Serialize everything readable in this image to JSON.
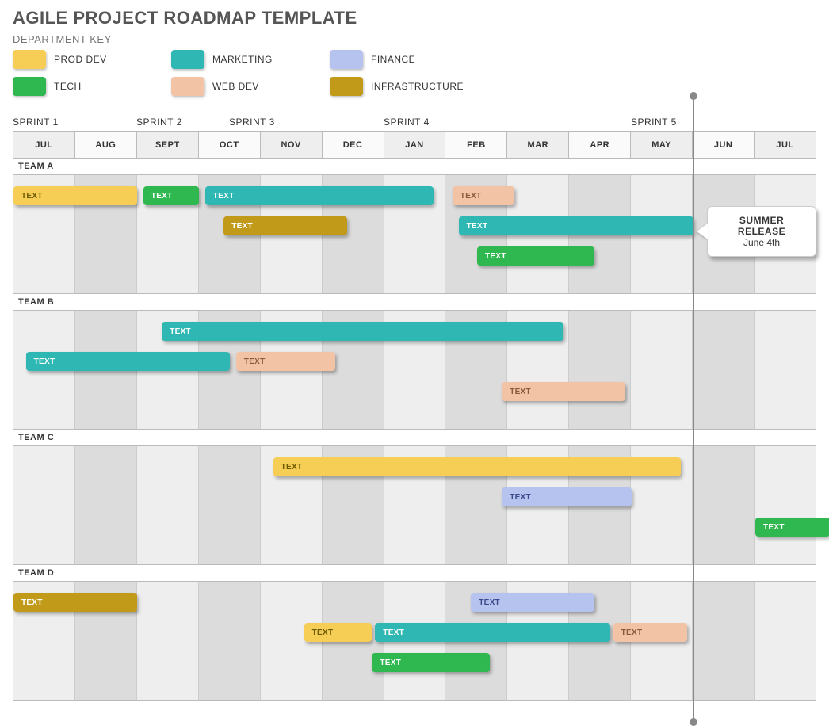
{
  "title": "AGILE PROJECT ROADMAP TEMPLATE",
  "key_title": "DEPARTMENT KEY",
  "colors": {
    "prod_dev": "#f6cd55",
    "marketing": "#2fb8b3",
    "finance": "#b6c3ef",
    "tech": "#2fb84f",
    "web_dev": "#f3c3a6",
    "infrastructure": "#c19a1a"
  },
  "legend": [
    {
      "label": "PROD DEV",
      "color": "prod_dev"
    },
    {
      "label": "MARKETING",
      "color": "marketing"
    },
    {
      "label": "FINANCE",
      "color": "finance"
    },
    {
      "label": "TECH",
      "color": "tech"
    },
    {
      "label": "WEB DEV",
      "color": "web_dev"
    },
    {
      "label": "INFRASTRUCTURE",
      "color": "infrastructure"
    }
  ],
  "sprints": [
    {
      "label": "SPRINT 1",
      "at_month": 0
    },
    {
      "label": "SPRINT 2",
      "at_month": 2
    },
    {
      "label": "SPRINT 3",
      "at_month": 3.5
    },
    {
      "label": "SPRINT 4",
      "at_month": 6
    },
    {
      "label": "SPRINT 5",
      "at_month": 10
    }
  ],
  "months": [
    "JUL",
    "AUG",
    "SEPT",
    "OCT",
    "NOV",
    "DEC",
    "JAN",
    "FEB",
    "MAR",
    "APR",
    "MAY",
    "JUN",
    "JUL"
  ],
  "teams": [
    "TEAM A",
    "TEAM B",
    "TEAM C",
    "TEAM D"
  ],
  "milestone": {
    "at_month": 11,
    "title": "SUMMER RELEASE",
    "subtitle": "June 4th"
  },
  "chart_data": {
    "type": "bar",
    "xlabel": "",
    "ylabel": "",
    "title": "AGILE PROJECT ROADMAP TEMPLATE",
    "x_categories": [
      "JUL",
      "AUG",
      "SEPT",
      "OCT",
      "NOV",
      "DEC",
      "JAN",
      "FEB",
      "MAR",
      "APR",
      "MAY",
      "JUN",
      "JUL"
    ],
    "series": [
      {
        "team": "TEAM A",
        "bars": [
          {
            "label": "TEXT",
            "dept": "prod_dev",
            "start": 0.0,
            "end": 2.0,
            "row": 0
          },
          {
            "label": "TEXT",
            "dept": "tech",
            "start": 2.1,
            "end": 3.0,
            "row": 0
          },
          {
            "label": "TEXT",
            "dept": "marketing",
            "start": 3.1,
            "end": 6.8,
            "row": 0
          },
          {
            "label": "TEXT",
            "dept": "web_dev",
            "start": 7.1,
            "end": 8.1,
            "row": 0
          },
          {
            "label": "TEXT",
            "dept": "infrastructure",
            "start": 3.4,
            "end": 5.4,
            "row": 1
          },
          {
            "label": "TEXT",
            "dept": "marketing",
            "start": 7.2,
            "end": 11.0,
            "row": 1
          },
          {
            "label": "TEXT",
            "dept": "tech",
            "start": 7.5,
            "end": 9.4,
            "row": 2
          }
        ]
      },
      {
        "team": "TEAM B",
        "bars": [
          {
            "label": "TEXT",
            "dept": "marketing",
            "start": 2.4,
            "end": 8.9,
            "row": 0
          },
          {
            "label": "TEXT",
            "dept": "marketing",
            "start": 0.2,
            "end": 3.5,
            "row": 1
          },
          {
            "label": "TEXT",
            "dept": "web_dev",
            "start": 3.6,
            "end": 5.2,
            "row": 1
          },
          {
            "label": "TEXT",
            "dept": "web_dev",
            "start": 7.9,
            "end": 9.9,
            "row": 2
          }
        ]
      },
      {
        "team": "TEAM C",
        "bars": [
          {
            "label": "TEXT",
            "dept": "prod_dev",
            "start": 4.2,
            "end": 10.8,
            "row": 0
          },
          {
            "label": "TEXT",
            "dept": "finance",
            "start": 7.9,
            "end": 10.0,
            "row": 1
          },
          {
            "label": "TEXT",
            "dept": "tech",
            "start": 12.0,
            "end": 13.2,
            "row": 2
          }
        ]
      },
      {
        "team": "TEAM D",
        "bars": [
          {
            "label": "TEXT",
            "dept": "infrastructure",
            "start": 0.0,
            "end": 2.0,
            "row": 0
          },
          {
            "label": "TEXT",
            "dept": "finance",
            "start": 7.4,
            "end": 9.4,
            "row": 0
          },
          {
            "label": "TEXT",
            "dept": "prod_dev",
            "start": 4.7,
            "end": 5.8,
            "row": 1
          },
          {
            "label": "TEXT",
            "dept": "marketing",
            "start": 5.85,
            "end": 9.65,
            "row": 1
          },
          {
            "label": "TEXT",
            "dept": "web_dev",
            "start": 9.7,
            "end": 10.9,
            "row": 1
          },
          {
            "label": "TEXT",
            "dept": "tech",
            "start": 5.8,
            "end": 7.7,
            "row": 2
          }
        ]
      }
    ],
    "milestone": {
      "at_month": 11,
      "title": "SUMMER RELEASE",
      "subtitle": "June 4th"
    }
  }
}
